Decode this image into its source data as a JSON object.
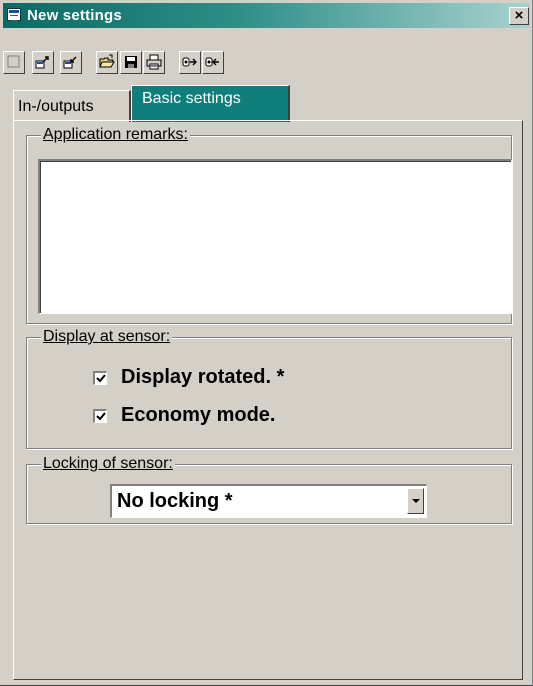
{
  "window": {
    "title": "New settings",
    "close_label": "×"
  },
  "toolbar": {
    "buttons": [
      {
        "icon": "new-blank-icon"
      },
      {
        "icon": "export-icon"
      },
      {
        "icon": "import-icon"
      },
      {
        "icon": "open-folder-icon"
      },
      {
        "icon": "save-disk-icon"
      },
      {
        "icon": "print-icon"
      },
      {
        "icon": "sensor-write-icon"
      },
      {
        "icon": "sensor-read-icon"
      }
    ]
  },
  "tabs": [
    {
      "label": "In-/outputs",
      "active": false
    },
    {
      "label": "Basic settings",
      "active": true
    }
  ],
  "groups": {
    "remarks": {
      "title": "Application remarks:",
      "value": ""
    },
    "display": {
      "title": "Display at sensor:",
      "options": [
        {
          "label": "Display rotated. *",
          "checked": true
        },
        {
          "label": "Economy mode.",
          "checked": true
        }
      ]
    },
    "locking": {
      "title": "Locking of sensor:",
      "selected": "No locking *"
    }
  },
  "colors": {
    "titlebar": "#0b6a64",
    "active_tab": "#107e7a",
    "face": "#d4d0c8"
  }
}
